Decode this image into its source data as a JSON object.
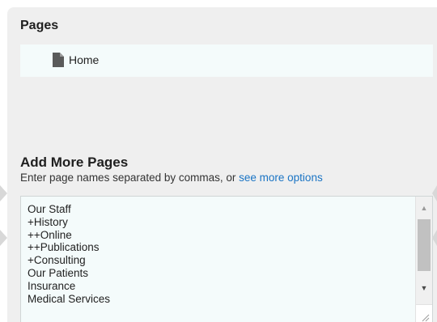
{
  "pages_section": {
    "title": "Pages",
    "items": [
      {
        "label": "Home",
        "icon": "page-icon"
      }
    ]
  },
  "add_section": {
    "title": "Add More Pages",
    "hint_prefix": "Enter page names separated by commas, or ",
    "hint_link": "see more options",
    "textarea_value": "Our Staff\n+History\n++Online\n++Publications\n+Consulting\nOur Patients\nInsurance\nMedical Services"
  },
  "icons": {
    "page": "page-icon",
    "scroll_up": "chevron-up-icon",
    "scroll_down": "chevron-down-icon",
    "resize": "resize-grip-icon",
    "nav_left": "chevron-left-icon",
    "nav_right": "chevron-right-icon"
  },
  "colors": {
    "panel_bg": "#efefef",
    "list_bg": "#f4fbfb",
    "link": "#1a74c4"
  }
}
